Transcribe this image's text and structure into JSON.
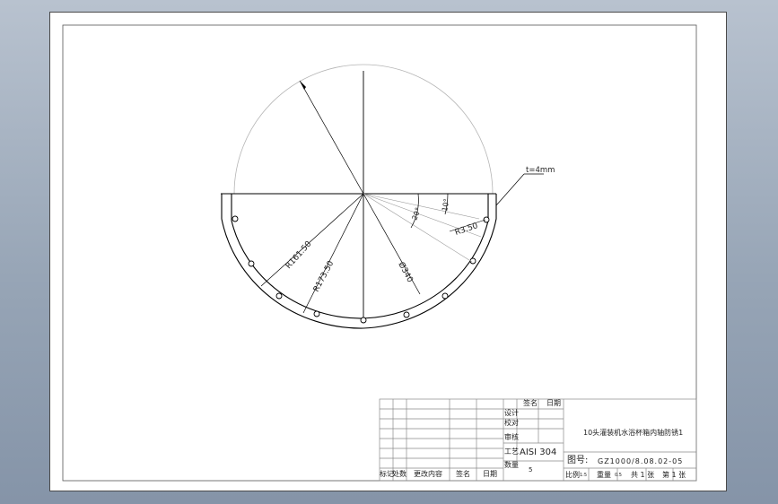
{
  "dimensions": {
    "outer_radius": "R161.50",
    "inner_radius": "R173.50",
    "diameter": "Ø340",
    "notch_radius": "R3.50",
    "angle_20": "20°",
    "angle_10": "10°",
    "thickness": "t=4mm"
  },
  "title_block": {
    "sign_header": "签名",
    "date_header": "日期",
    "design": "设计",
    "check": "校对",
    "audit": "审核",
    "process": "工艺",
    "material": "AISI 304",
    "quantity_label": "数量",
    "quantity_value": "5",
    "part_name": "10头灌装机水浴杯箱内轴防锈1",
    "drawing_no_label": "图号:",
    "drawing_no": "GZ1000/8.08.02-05",
    "scale_label": "比例",
    "scale_value": "1:5",
    "weight_label": "重量",
    "weight_value": "0.5",
    "sheets_total": "共 1 张",
    "sheet_no": "第 1 张",
    "rev_mark": "标记",
    "rev_count": "处数",
    "rev_doc": "更改内容",
    "rev_sign": "签名",
    "rev_date": "日期"
  }
}
